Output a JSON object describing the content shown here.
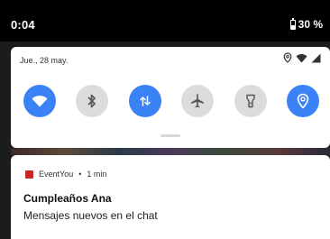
{
  "status_bar": {
    "time": "0:04",
    "battery_percent": "30 %",
    "battery_icon": "battery-icon"
  },
  "quick_settings": {
    "date": "Jue., 28 may.",
    "status_icons": [
      "location-icon",
      "wifi-icon",
      "signal-icon"
    ],
    "tiles": [
      {
        "name": "wifi",
        "icon": "wifi-icon",
        "active": true
      },
      {
        "name": "bluetooth",
        "icon": "bluetooth-icon",
        "active": false
      },
      {
        "name": "mobile-data",
        "icon": "data-transfer-icon",
        "active": true
      },
      {
        "name": "airplane-mode",
        "icon": "airplane-icon",
        "active": false
      },
      {
        "name": "flashlight",
        "icon": "flashlight-icon",
        "active": false
      },
      {
        "name": "location",
        "icon": "location-icon",
        "active": true
      }
    ],
    "accent_color": "#3b82f6",
    "inactive_color": "#dcdcdc"
  },
  "notification": {
    "app_name": "EventYou",
    "separator": "•",
    "time": "1 min",
    "app_icon_color": "#c62828",
    "title": "Cumpleaños Ana",
    "text": "Mensajes nuevos en el chat"
  }
}
